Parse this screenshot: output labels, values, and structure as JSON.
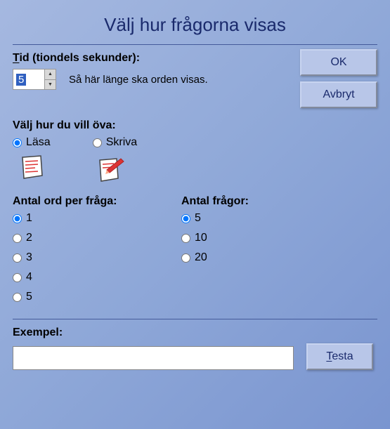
{
  "title": "Välj hur frågorna visas",
  "time": {
    "label_pre": "T",
    "label_post": "id (tiondels sekunder):",
    "value": "5",
    "hint": "Så här länge ska orden visas."
  },
  "buttons": {
    "ok": "OK",
    "cancel": "Avbryt",
    "test_pre": "T",
    "test_post": "esta"
  },
  "practice": {
    "label": "Välj hur du vill öva:",
    "options": {
      "read": "Läsa",
      "write": "Skriva"
    },
    "selected": "read"
  },
  "words_per_q": {
    "label": "Antal ord per fråga:",
    "options": [
      "1",
      "2",
      "3",
      "4",
      "5"
    ],
    "selected": "1"
  },
  "num_questions": {
    "label": "Antal frågor:",
    "options": [
      "5",
      "10",
      "20"
    ],
    "selected": "5"
  },
  "example": {
    "label": "Exempel:",
    "value": ""
  }
}
